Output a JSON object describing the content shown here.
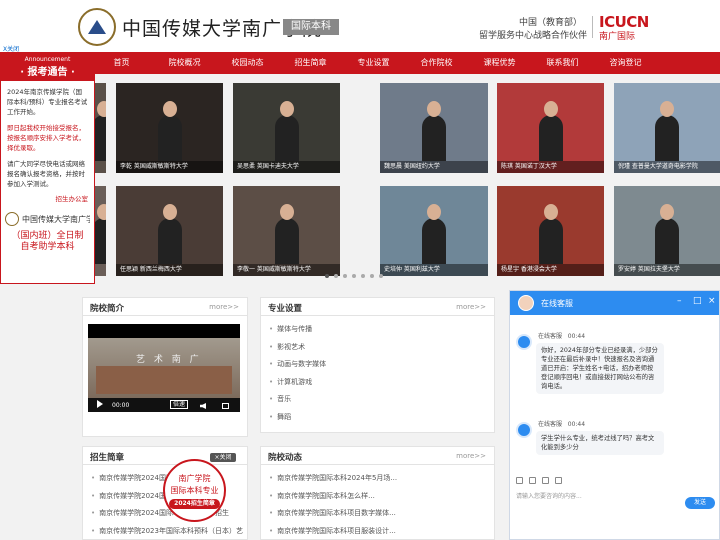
{
  "header": {
    "school_name": "中国传媒大学南广学院",
    "intl_badge": "国际本科",
    "right_line1": "中国（教育部）",
    "right_line2": "留学服务中心战略合作伙伴",
    "icucn_logo": "ICUCN",
    "icucn_sub": "南广国际",
    "close_link": "X关闭"
  },
  "nav": {
    "items": [
      "首页",
      "院校概况",
      "校园动态",
      "招生简章",
      "专业设置",
      "合作院校",
      "课程优势",
      "联系我们",
      "咨询登记"
    ]
  },
  "announcement": {
    "title_en": "Announcement",
    "title_zh": "· 报考通告 ·",
    "p1": "2024年南京传媒学院（国际本科/预科）专业报名考试工作开始。",
    "p2": "即日起我校开始接受报名，按报名顺序安排入学考试，择优录取。",
    "p3": "请广大同学尽快电话或网络报名确认报考资格，并按时参加入学测试。",
    "sign": "招生办公室",
    "logo_text": "中国传媒大学南广学院",
    "program_line1": "（国内班）全日制",
    "program_line2": "自考助学本科"
  },
  "gallery": {
    "items": [
      {
        "caption": "李乾  英国威斯敏斯特大学",
        "bg": "#2b2522"
      },
      {
        "caption": "吴思柔  英国卡迪夫大学",
        "bg": "#3a3a34"
      },
      {
        "caption": "魏思晨  美国纽约大学",
        "bg": "#6f7b8a"
      },
      {
        "caption": "陈琪  英国诺丁汉大学",
        "bg": "#b23a3a"
      },
      {
        "caption": "倪瑾  查普曼大学道奇电影学院",
        "bg": "#8ea3b8"
      },
      {
        "caption": "任思颖  新西兰梅西大学",
        "bg": "#4a3c36"
      },
      {
        "caption": "李敬一  英国威斯敏斯特大学",
        "bg": "#5c4e46"
      },
      {
        "caption": "史培仲  英国利兹大学",
        "bg": "#6f8798"
      },
      {
        "caption": "杨星宇  香港浸会大学",
        "bg": "#9a3a2e"
      },
      {
        "caption": "罗安婷  英国拉夫堡大学",
        "bg": "#7e8a90"
      },
      {
        "caption": "",
        "bg": "#5a5048"
      },
      {
        "caption": "",
        "bg": "#6a5e58"
      }
    ]
  },
  "panels": {
    "intro": {
      "title": "院校简介",
      "more": "more>>"
    },
    "majors": {
      "title": "专业设置",
      "more": "more>>",
      "items": [
        "媒体与传播",
        "影视艺术",
        "动画与数字媒体",
        "计算机游戏",
        "音乐",
        "舞蹈"
      ]
    },
    "admission": {
      "title": "招生简章",
      "close": "×关闭",
      "items": [
        "南京传媒学院2024国际本科招生简章",
        "南京传媒学院2024国际本科预科简章",
        "南京传媒学院2024国际本科（日本）招生",
        "南京传媒学院2023年国际本科预科（日本）艺"
      ]
    },
    "news": {
      "title": "院校动态",
      "more": "more>>",
      "items": [
        "南京传媒学院国际本科2024年5月场...",
        "南京传媒学院国际本科怎么样...",
        "南京传媒学院国际本科项目数字媒体...",
        "南京传媒学院国际本科项目服装设计..."
      ]
    }
  },
  "video": {
    "title": "艺 术 南 广",
    "time": "00:00",
    "speed": "倍速"
  },
  "seal": {
    "line1": "南广学院",
    "line2": "国际本科专业",
    "line3": "2024招生简章"
  },
  "chat": {
    "title": "在线客服",
    "msg1_sender": "在线客服",
    "msg1_time": "00:44",
    "msg1_text": "你好，2024年部分专业已经录满，少部分专业还在最后补录中！快速报名及咨询通道已开启：学生姓名+电话，招办老师按登记顺序回电！或直接拨打网站公布的咨询电话。",
    "msg2_sender": "在线客服",
    "msg2_time": "00:44",
    "msg2_text": "学生学什么专业，统考过线了吗？高考文化能到多少分",
    "input_placeholder": "请输入您要咨询的内容...",
    "send_label": "发送"
  }
}
